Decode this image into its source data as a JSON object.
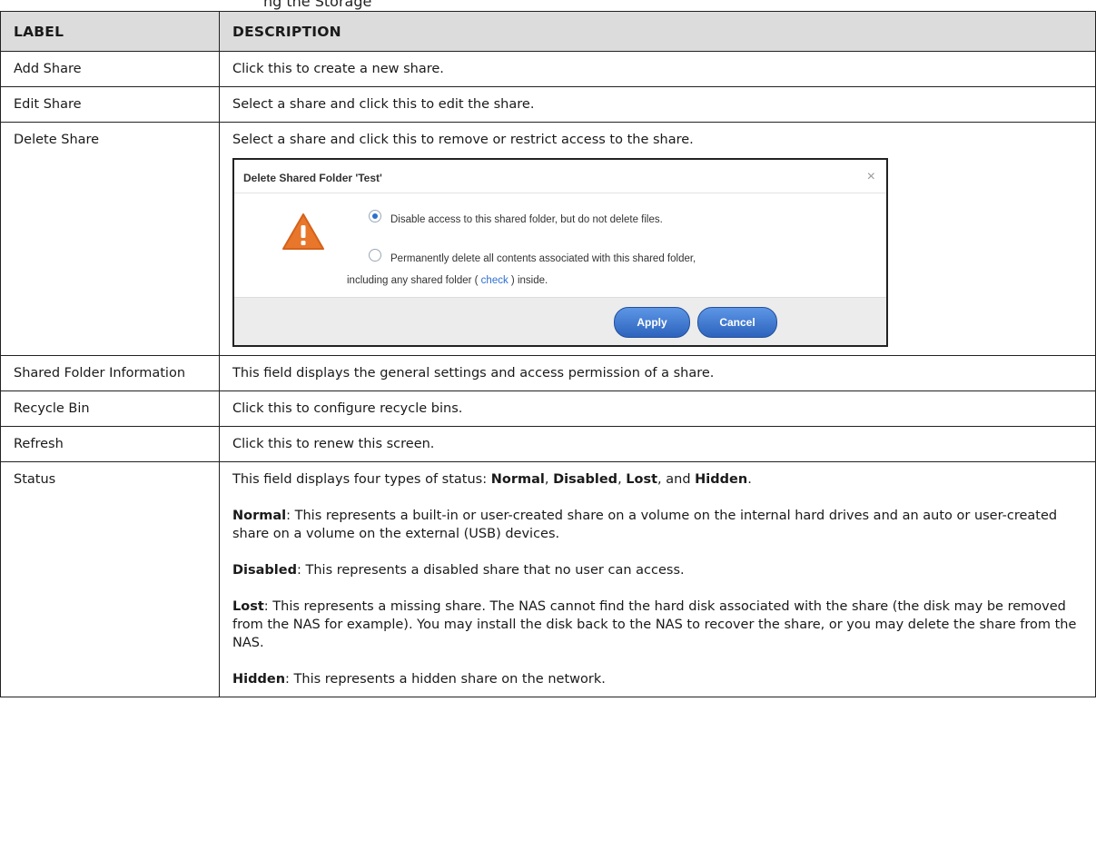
{
  "top_text": "ng the Storage",
  "table": {
    "headers": [
      "LABEL",
      "DESCRIPTION"
    ],
    "rows": [
      {
        "label": "Add Share",
        "desc": "Click this to create a new share."
      },
      {
        "label": "Edit Share",
        "desc": "Select a share and click this to edit the share."
      },
      {
        "label": "Delete Share",
        "desc": "Select a share and click this to remove or restrict access to the share."
      },
      {
        "label": "Shared Folder Information",
        "desc": "This field displays the general settings and access permission of a share."
      },
      {
        "label": "Recycle Bin",
        "desc": "Click this to configure recycle bins."
      },
      {
        "label": "Refresh",
        "desc": "Click this to renew this screen."
      },
      {
        "label": "Status"
      }
    ]
  },
  "status": {
    "intro_pre": "This field displays four types of status: ",
    "types": [
      "Normal",
      "Disabled",
      "Lost",
      "Hidden"
    ],
    "sep1": ", ",
    "sep2": ", ",
    "sep3": ", and ",
    "end": ".",
    "colon": ": ",
    "normal_desc": "This represents a built-in or user-created share on a volume on the internal hard drives and an auto or user-created share on a volume on the external (USB) devices.",
    "disabled_desc": "This represents a disabled share that no user can access.",
    "lost_desc": "This represents a missing share. The NAS cannot find the hard disk associated with the share (the disk may be removed from the NAS for example). You may install the disk back to the NAS to recover the share, or you may delete the share from the NAS.",
    "hidden_desc": "This represents a hidden share on the network."
  },
  "dialog": {
    "title": "Delete Shared Folder 'Test'",
    "close": "×",
    "option1": "Disable access to this shared folder, but do not delete files.",
    "option1_selected": true,
    "option2_line1": "Permanently delete all contents associated with this shared folder,",
    "option2_line2_pre": "including any shared folder ( ",
    "option2_link": "check",
    "option2_line2_post": " ) inside.",
    "apply": "Apply",
    "cancel": "Cancel"
  }
}
